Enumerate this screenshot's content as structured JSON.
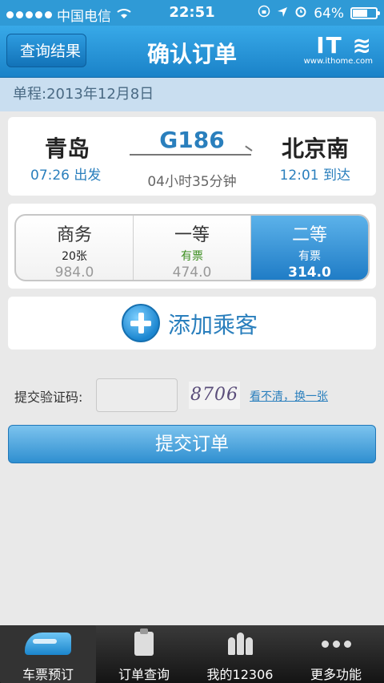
{
  "status_bar": {
    "carrier": "中国电信",
    "time": "22:51",
    "battery": "64%",
    "battery_level": 0.64
  },
  "nav": {
    "back_label": "查询结果",
    "title": "确认订单",
    "logo_text": "IT之家",
    "logo_url": "www.ithome.com"
  },
  "trip": {
    "date_label": "单程:2013年12月8日",
    "from_city": "青岛",
    "from_time": "07:26 出发",
    "to_city": "北京南",
    "to_time": "12:01 到达",
    "train_no": "G186",
    "duration": "04小时35分钟"
  },
  "seats": [
    {
      "name": "商务",
      "count": "20张",
      "price": "984.0"
    },
    {
      "name": "一等",
      "count": "有票",
      "price": "474.0"
    },
    {
      "name": "二等",
      "count": "有票",
      "price": "314.0"
    }
  ],
  "add_passenger_label": "添加乘客",
  "captcha": {
    "label": "提交验证码:",
    "value": "",
    "image_text": "8706",
    "refresh_label": "看不清，换一张"
  },
  "submit_label": "提交订单",
  "tabs": [
    {
      "label": "车票预订",
      "icon": "train-icon"
    },
    {
      "label": "订单查询",
      "icon": "clipboard-icon"
    },
    {
      "label": "我的12306",
      "icon": "people-icon"
    },
    {
      "label": "更多功能",
      "icon": "more-icon"
    }
  ]
}
